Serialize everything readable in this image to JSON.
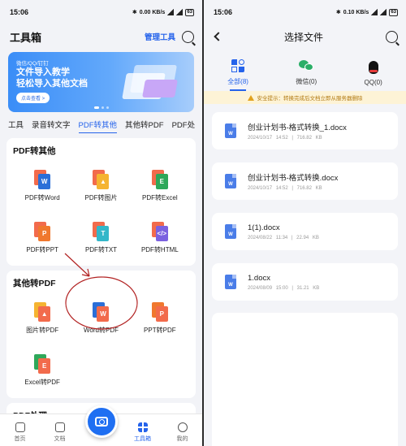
{
  "left": {
    "status": {
      "time": "15:06",
      "net": "0.00 KB/s",
      "battery": "63"
    },
    "header": {
      "title": "工具箱",
      "manage": "管理工具"
    },
    "banner": {
      "sub": "微信/QQ/钉钉",
      "line1": "文件导入教学",
      "line2": "轻松导入其他文档",
      "button": "点击查看 >"
    },
    "tabs": [
      "工具",
      "录音转文字",
      "PDF转其他",
      "其他转PDF",
      "PDF处"
    ],
    "active_tab": "PDF转其他",
    "section1": {
      "title": "PDF转其他",
      "items": [
        {
          "label": "PDF转Word",
          "glyph": "W",
          "back": "#f26b4c",
          "front": "#2b6fd8"
        },
        {
          "label": "PDF转图片",
          "glyph": "▲",
          "back": "#f26b4c",
          "front": "#f5b431"
        },
        {
          "label": "PDF转Excel",
          "glyph": "E",
          "back": "#f26b4c",
          "front": "#2ea85a"
        },
        {
          "label": "PDF转PPT",
          "glyph": "P",
          "back": "#f26b4c",
          "front": "#f0782e"
        },
        {
          "label": "PDF转TXT",
          "glyph": "T",
          "back": "#f26b4c",
          "front": "#33b7c9"
        },
        {
          "label": "PDF转HTML",
          "glyph": "</>",
          "back": "#f26b4c",
          "front": "#7b61e0"
        }
      ]
    },
    "section2": {
      "title": "其他转PDF",
      "items": [
        {
          "label": "图片转PDF",
          "glyph": "▲",
          "back": "#f5b431",
          "front": "#f26b4c"
        },
        {
          "label": "Word转PDF",
          "glyph": "W",
          "back": "#2b6fd8",
          "front": "#f26b4c"
        },
        {
          "label": "PPT转PDF",
          "glyph": "P",
          "back": "#f0782e",
          "front": "#f26b4c"
        },
        {
          "label": "Excel转PDF",
          "glyph": "E",
          "back": "#2ea85a",
          "front": "#f26b4c"
        }
      ]
    },
    "section3": {
      "title": "PDF处理"
    },
    "nav": [
      {
        "label": "首页",
        "icon": "home-icon"
      },
      {
        "label": "文档",
        "icon": "document-icon"
      },
      {
        "label": "",
        "icon": "camera-icon"
      },
      {
        "label": "工具箱",
        "icon": "grid-icon"
      },
      {
        "label": "我的",
        "icon": "user-icon"
      }
    ]
  },
  "right": {
    "status": {
      "time": "15:06",
      "net": "0.10 KB/s",
      "battery": "63"
    },
    "header": {
      "title": "选择文件"
    },
    "sources": [
      {
        "label": "全部(8)",
        "icon": "all-files-icon",
        "active": true
      },
      {
        "label": "微信(0)",
        "icon": "wechat-icon",
        "active": false
      },
      {
        "label": "QQ(0)",
        "icon": "qq-icon",
        "active": false
      }
    ],
    "notice": "安全提示：转换完成后文档立即从服务器删除",
    "files": [
      {
        "name": "创业计划书-格式转换_1.docx",
        "date": "2024/10/17 14:52",
        "size": "716.82 KB"
      },
      {
        "name": "创业计划书-格式转换.docx",
        "date": "2024/10/17 14:52",
        "size": "716.82 KB"
      },
      {
        "name": "1(1).docx",
        "date": "2024/08/22 11:34",
        "size": "22.94 KB"
      },
      {
        "name": "1.docx",
        "date": "2024/08/09 15:00",
        "size": "31.21 KB"
      }
    ]
  },
  "colors": {
    "accent": "#2563eb",
    "annotation": "#b22222",
    "notice_bg": "#fdf3d6"
  }
}
